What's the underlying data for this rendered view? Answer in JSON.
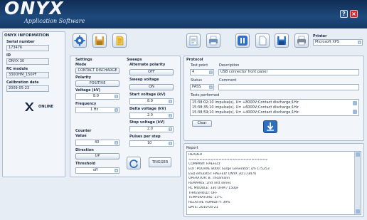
{
  "app": {
    "name": "ONYX",
    "subtitle": "Application Software"
  },
  "window": {
    "help_label": "?",
    "close_label": "×"
  },
  "info": {
    "title": "ONYX INFORMATION",
    "serial_label": "Serial number",
    "serial_value": "173476",
    "id_label": "ID",
    "id_value": "ONYX 30",
    "rc_label": "RC module",
    "rc_value": "330OHM_150PF",
    "cal_label": "Calibration date",
    "cal_value": "2009-05-23",
    "status_text": "ONLINE"
  },
  "settings": {
    "title": "Settings",
    "mode_label": "Mode",
    "mode_value": "CONTACT DISCHARGE",
    "polarity_label": "Polarity",
    "polarity_value": "POSITIVE",
    "voltage_label": "Voltage (kV)",
    "voltage_value": "8.0",
    "frequency_label": "Frequency",
    "frequency_value": "1 Hz"
  },
  "counter": {
    "title": "Counter",
    "value_label": "Value",
    "value_value": "40",
    "direction_label": "Direction",
    "direction_value": "UP",
    "threshold_label": "Threshold",
    "threshold_value": "off"
  },
  "sweeps": {
    "title": "Sweeps",
    "alt_label": "Alternate polarity",
    "alt_value": "OFF",
    "sweepv_label": "Sweep voltage",
    "sweepv_value": "ON",
    "start_label": "Start voltage (kV)",
    "start_value": "8.0",
    "delta_label": "Delta voltage (kV)",
    "delta_value": "2.0",
    "stop_label": "Stop voltage (kV)",
    "stop_value": "2.0",
    "pulses_label": "Pulses per step",
    "pulses_value": "10",
    "trigger_label": "TRIGGER"
  },
  "printer": {
    "label": "Printer",
    "value": "Microsoft XPS"
  },
  "protocol": {
    "title": "Protocol",
    "testpoint_label": "Test point",
    "testpoint_value": "4",
    "description_label": "Description",
    "description_value": "USB connector front panel",
    "status_label": "Status",
    "status_value": "PASS",
    "comment_label": "Comment",
    "comment_value": "",
    "tests_label": "Tests performed",
    "tests": [
      "15:38:02;10 impulse(s), U= +8000V;Contact discharge;1Hz",
      "15:38:35;10 impulse(s), U= +6000V;Contact discharge;1Hz",
      "15:38:59;10 impulse(s), U= +4000V;Contact discharge;1Hz"
    ],
    "clear_label": "Clear"
  },
  "report": {
    "title": "Report",
    "header_value": "HEADER",
    "lines": [
      "=============================",
      "COMPANY: HAEFELY",
      "EUT: POURXE 8000; Surge Generator; s/n 175253",
      "ESD emulator: HAEFELY ONYX 30;173476",
      "OPERATOR: B. Thoamann",
      "REMARKS: 2nd Test series",
      "RC MODULE: 330 OHM / 150pF",
      "THRESHOLD: OFF",
      "TEMPERATURE: 23°C",
      "RELATIVE HUMIDITY: 39%",
      "DATE: 2010-05-21"
    ]
  },
  "colors": {
    "header": "#1e4a7c",
    "accent": "#2f6fc0",
    "online": "#12223a",
    "close": "#d02828"
  },
  "icons": {
    "toolbar_left": [
      "settings-gear-icon",
      "save-disk-icon",
      "notes-icon"
    ],
    "toolbar_right": [
      "report-icon",
      "print-icon",
      "pause-icon",
      "new-document-icon",
      "floppy-save-icon",
      "printer-icon"
    ],
    "refresh": "refresh-icon",
    "download": "download-arrow-icon",
    "online": "x-logo-icon"
  }
}
